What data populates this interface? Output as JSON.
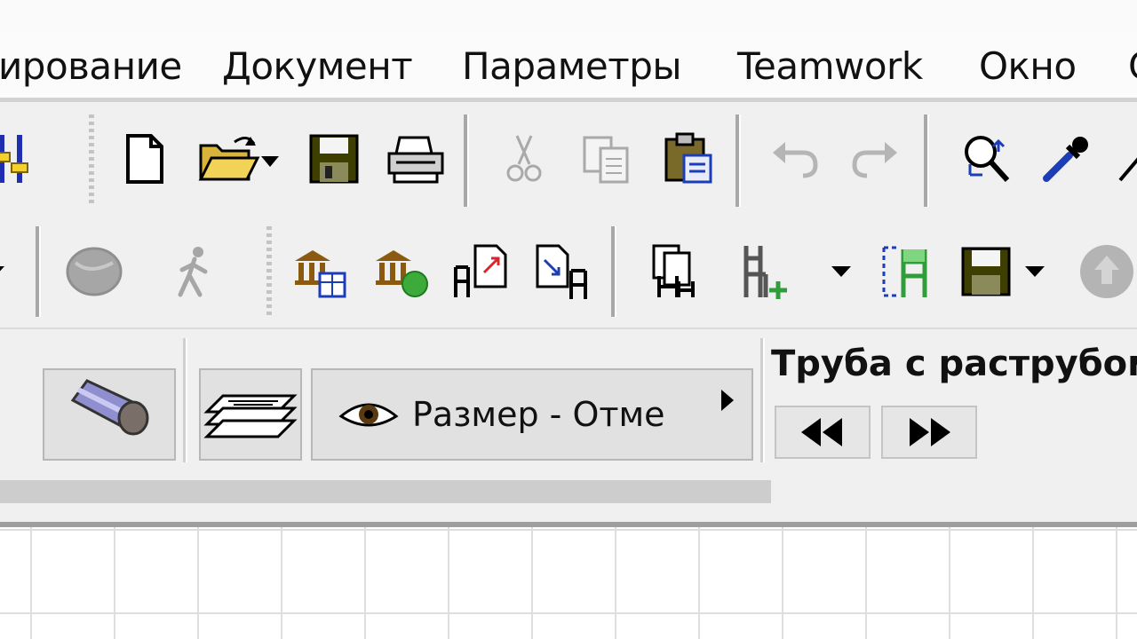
{
  "menu": {
    "items": [
      "ирование",
      "Документ",
      "Параметры",
      "Teamwork",
      "Окно"
    ]
  },
  "toolbar1": {
    "icons": [
      "layer-sliders-icon",
      "new-document-icon",
      "open-folder-icon",
      "save-icon",
      "print-icon",
      "cut-icon",
      "copy-icon",
      "paste-icon",
      "undo-icon",
      "redo-icon",
      "zoom-icon",
      "eyedropper-icon"
    ]
  },
  "toolbar2": {
    "icons": [
      "globe-icon",
      "walker-icon",
      "library-table-icon",
      "library-globe-icon",
      "chair-export-icon",
      "chair-import-icon",
      "chairs-copy-icon",
      "chair-add-icon",
      "chair-select-icon",
      "save-icon",
      "globe-arrow-icon"
    ]
  },
  "infobox": {
    "view_label": "Размер - Отме",
    "element_title": "Труба с раструбом"
  },
  "colors": {
    "folder": "#e9c24a",
    "save": "#4a4a00",
    "highlight": "#1c3db8",
    "green": "#2f9e3a"
  }
}
